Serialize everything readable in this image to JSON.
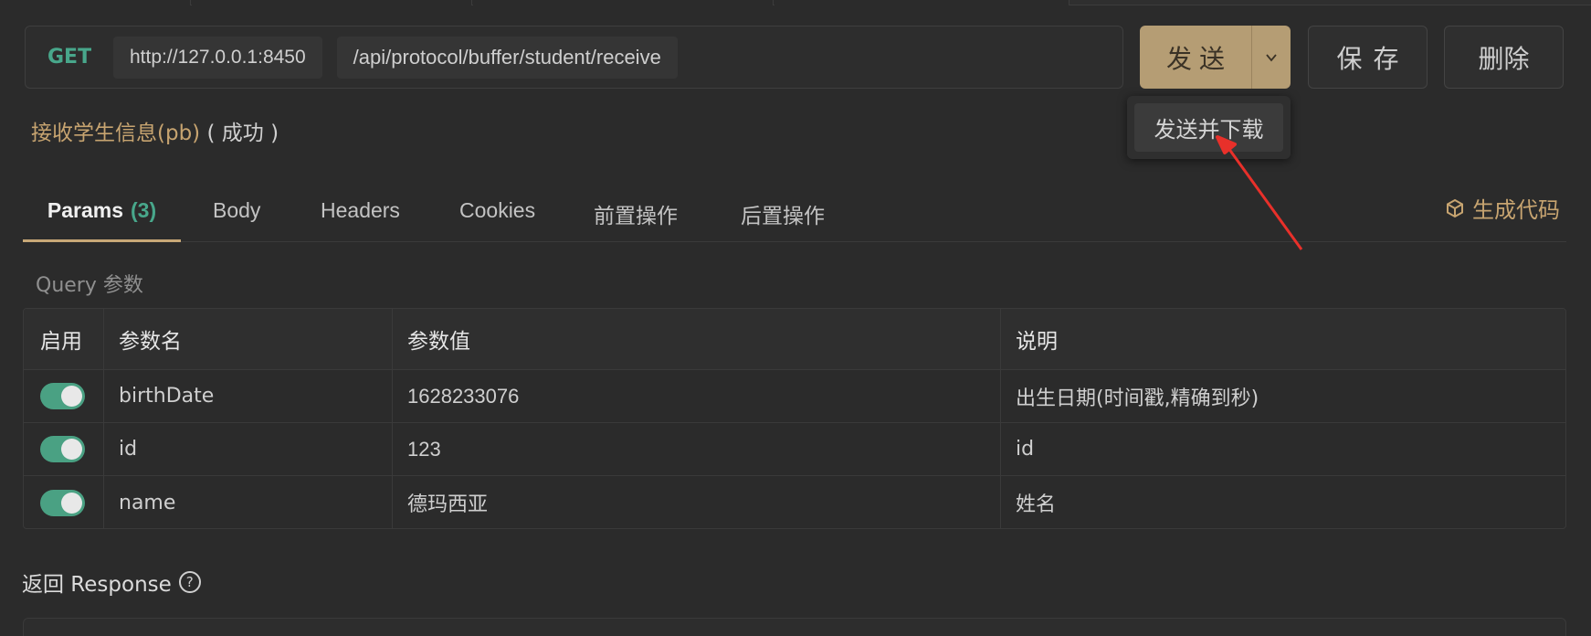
{
  "request": {
    "method": "GET",
    "host": "http://127.0.0.1:8450",
    "path": "/api/protocol/buffer/student/receive",
    "name": "接收学生信息(pb)",
    "status": "( 成功 )"
  },
  "actions": {
    "send_label": "发送",
    "save_label": "保存",
    "delete_label": "删除",
    "dropdown_item": "发送并下载"
  },
  "tabs": [
    {
      "label": "Params",
      "count": "(3)"
    },
    {
      "label": "Body"
    },
    {
      "label": "Headers"
    },
    {
      "label": "Cookies"
    },
    {
      "label": "前置操作"
    },
    {
      "label": "后置操作"
    }
  ],
  "gen_code_label": "生成代码",
  "query_label": "Query 参数",
  "params_table": {
    "headers": [
      "启用",
      "参数名",
      "参数值",
      "说明"
    ],
    "rows": [
      {
        "enabled": true,
        "name": "birthDate",
        "value": "1628233076",
        "desc": "出生日期(时间戳,精确到秒)"
      },
      {
        "enabled": true,
        "name": "id",
        "value": "123",
        "desc": "id"
      },
      {
        "enabled": true,
        "name": "name",
        "value": "德玛西亚",
        "desc": "姓名"
      }
    ]
  },
  "response_label": "返回 Response",
  "colors": {
    "accent": "#c7a470",
    "send_button": "#b59d74",
    "method_get": "#48a78b",
    "toggle_on": "#4aa183",
    "annotation_arrow": "#e8302a"
  }
}
